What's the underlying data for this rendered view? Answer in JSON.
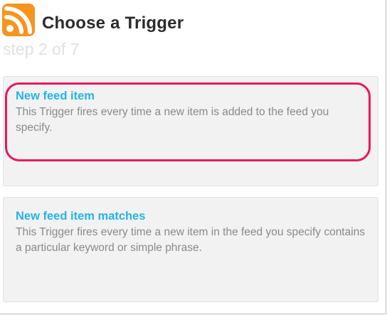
{
  "header": {
    "icon": "rss-feed-icon",
    "title": "Choose a Trigger",
    "step": "step 2 of 7"
  },
  "triggers": [
    {
      "title": "New feed item",
      "description": "This Trigger fires every time a new item is added to the feed you specify."
    },
    {
      "title": "New feed item matches",
      "description": "This Trigger fires every time a new item in the feed you specify contains a particular keyword or simple phrase."
    }
  ],
  "colors": {
    "rss_orange": "#f7941d",
    "title_text": "#2b2b2b",
    "step_text": "#e2e2e2",
    "link_blue": "#26b3e6",
    "description_text": "#8a8a8a",
    "card_background": "#f2f2f2",
    "highlight_annotation": "#e8185a"
  }
}
